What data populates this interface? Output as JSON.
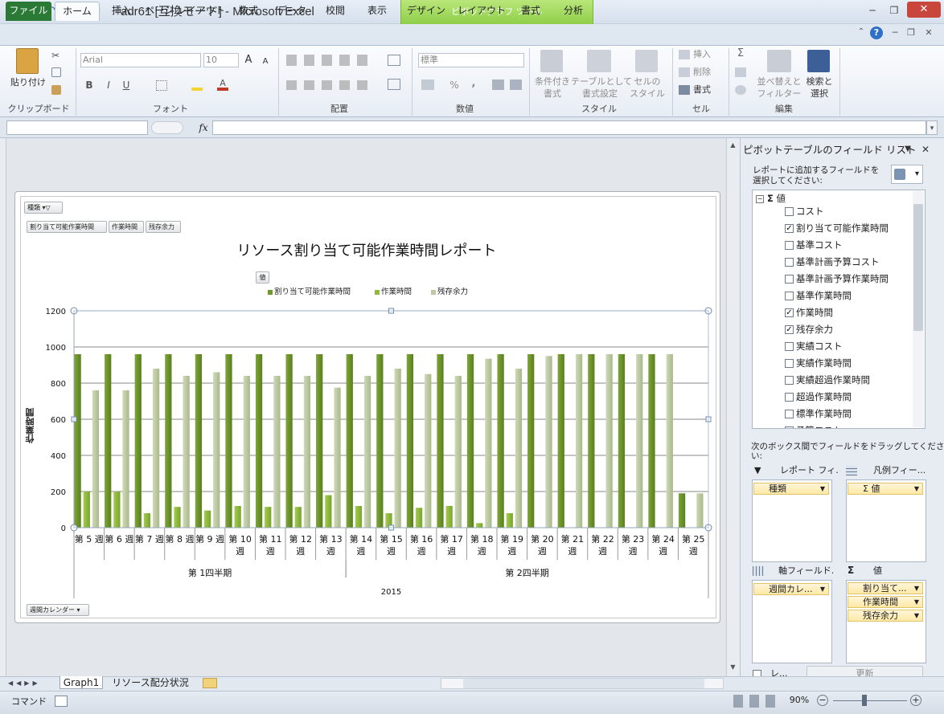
{
  "window": {
    "title": "adr61  [互換モード] - Microsoft Excel",
    "context_tab": "ピボットグラフ ツール",
    "controls": {
      "minimize": "─",
      "restore": "❐",
      "close": "✕"
    }
  },
  "tabs": {
    "file": "ファイル",
    "home": "ホーム",
    "items": [
      "挿入",
      "ページ レイアウト",
      "数式",
      "データ",
      "校閲",
      "表示",
      "デザイン",
      "レイアウト",
      "書式",
      "分析"
    ]
  },
  "ribbon": {
    "clipboard": {
      "label": "クリップボード",
      "paste": "貼り付け"
    },
    "font": {
      "label": "フォント",
      "name": "Arial",
      "size": "10",
      "bold": "B",
      "italic": "I",
      "underline": "U",
      "grow": "A",
      "shrink": "A"
    },
    "alignment": {
      "label": "配置"
    },
    "number": {
      "label": "数値",
      "format": "標準",
      "percent": "%",
      "comma": ","
    },
    "style": {
      "label": "スタイル",
      "conditional": [
        "条件付き",
        "書式"
      ],
      "table": [
        "テーブルとして",
        "書式設定"
      ],
      "cell": [
        "セルの",
        "スタイル"
      ]
    },
    "cells": {
      "label": "セル",
      "insert": "挿入",
      "delete": "削除",
      "format": "書式"
    },
    "editing": {
      "label": "編集",
      "sigma": "Σ",
      "sort": [
        "並べ替えと",
        "フィルター"
      ],
      "find": [
        "検索と",
        "選択"
      ]
    }
  },
  "formula_bar": {
    "fx": "fx",
    "name_value": "",
    "formula_value": ""
  },
  "chart": {
    "filter_button": "種類",
    "value_buttons": [
      "割り当て可能作業時間",
      "作業時間",
      "残存余力"
    ],
    "values_button": "値",
    "axis_field_button": "週間カレンダー"
  },
  "chart_data": {
    "type": "bar",
    "title": "リソース割り当て可能作業時間レポート",
    "ylabel": "作業時間",
    "ylim": [
      0,
      1200
    ],
    "yticks": [
      0,
      200,
      400,
      600,
      800,
      1000,
      1200
    ],
    "grid": true,
    "legend_position": "top",
    "categories": [
      "第 5 週",
      "第 6 週",
      "第 7 週",
      "第 8 週",
      "第 9 週",
      "第 10 週",
      "第 11 週",
      "第 12 週",
      "第 13 週",
      "第 14 週",
      "第 15 週",
      "第 16 週",
      "第 17 週",
      "第 18 週",
      "第 19 週",
      "第 20 週",
      "第 21 週",
      "第 22 週",
      "第 23 週",
      "第 24 週",
      "第 25 週"
    ],
    "category_lines": [
      [
        "第 5 週"
      ],
      [
        "第 6 週"
      ],
      [
        "第 7 週"
      ],
      [
        "第 8 週"
      ],
      [
        "第 9 週"
      ],
      [
        "第 10",
        "週"
      ],
      [
        "第 11",
        "週"
      ],
      [
        "第 12",
        "週"
      ],
      [
        "第 13",
        "週"
      ],
      [
        "第 14",
        "週"
      ],
      [
        "第 15",
        "週"
      ],
      [
        "第 16",
        "週"
      ],
      [
        "第 17",
        "週"
      ],
      [
        "第 18",
        "週"
      ],
      [
        "第 19",
        "週"
      ],
      [
        "第 20",
        "週"
      ],
      [
        "第 21",
        "週"
      ],
      [
        "第 22",
        "週"
      ],
      [
        "第 23",
        "週"
      ],
      [
        "第 24",
        "週"
      ],
      [
        "第 25",
        "週"
      ]
    ],
    "quarters": [
      {
        "label": "第 1四半期",
        "from": 0,
        "to": 9
      },
      {
        "label": "第 2四半期",
        "from": 9,
        "to": 21
      }
    ],
    "year": "2015",
    "series": [
      {
        "name": "割り当て可能作業時間",
        "color": "#6f9a2a",
        "values": [
          960,
          960,
          960,
          960,
          960,
          960,
          960,
          960,
          960,
          960,
          960,
          960,
          960,
          960,
          960,
          960,
          960,
          960,
          960,
          960,
          190
        ]
      },
      {
        "name": "作業時間",
        "color": "#8fba3c",
        "values": [
          200,
          200,
          80,
          115,
          95,
          120,
          115,
          115,
          180,
          120,
          80,
          110,
          120,
          25,
          80,
          0,
          0,
          0,
          0,
          0,
          0
        ]
      },
      {
        "name": "残存余力",
        "color": "#bcc9a2",
        "values": [
          760,
          760,
          880,
          840,
          860,
          840,
          840,
          840,
          775,
          840,
          880,
          850,
          840,
          935,
          880,
          950,
          960,
          960,
          960,
          960,
          190
        ]
      }
    ]
  },
  "field_pane": {
    "title": "ピボットテーブルのフィールド リスト",
    "instruction": [
      "レポートに追加するフィールドを",
      "選択してください:"
    ],
    "group": "値",
    "fields": [
      {
        "label": "コスト",
        "checked": false
      },
      {
        "label": "割り当て可能作業時間",
        "checked": true
      },
      {
        "label": "基準コスト",
        "checked": false
      },
      {
        "label": "基準計画予算コスト",
        "checked": false
      },
      {
        "label": "基準計画予算作業時間",
        "checked": false
      },
      {
        "label": "基準作業時間",
        "checked": false
      },
      {
        "label": "作業時間",
        "checked": true
      },
      {
        "label": "残存余力",
        "checked": true
      },
      {
        "label": "実績コスト",
        "checked": false
      },
      {
        "label": "実績作業時間",
        "checked": false
      },
      {
        "label": "実績超過作業時間",
        "checked": false
      },
      {
        "label": "超過作業時間",
        "checked": false
      },
      {
        "label": "標準作業時間",
        "checked": false
      },
      {
        "label": "予算コスト",
        "checked": false
      }
    ],
    "drag_text": [
      "次のボックス間でフィールドをドラッグしてくださ",
      "い:"
    ],
    "areas": {
      "report_filter": {
        "label": "レポート フィ...",
        "items": [
          "種類"
        ]
      },
      "legend_fields": {
        "label": "凡例フィー...",
        "items": [
          "Σ 値"
        ]
      },
      "axis_fields": {
        "label": "軸フィールド...",
        "items": [
          "週間カレ..."
        ]
      },
      "values": {
        "label": "値",
        "items": [
          "割り当て...",
          "作業時間",
          "残存余力"
        ]
      }
    },
    "defer_label": "レ...",
    "update_button": "更新"
  },
  "sheets": {
    "tabs": [
      "Graph1",
      "リソース配分状況"
    ]
  },
  "statusbar": {
    "mode": "コマンド",
    "zoom": "90%"
  }
}
